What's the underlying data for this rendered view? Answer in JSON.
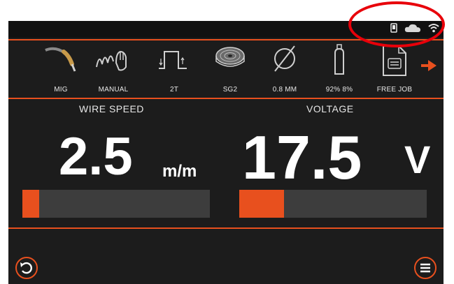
{
  "status_icons": [
    "phone-icon",
    "cloud-icon",
    "wifi-icon"
  ],
  "toolbar": {
    "items": [
      {
        "label": "MIG",
        "icon": "mig-torch-icon"
      },
      {
        "label": "MANUAL",
        "icon": "manual-mode-icon"
      },
      {
        "label": "2T",
        "icon": "trigger-2t-icon"
      },
      {
        "label": "SG2",
        "icon": "wire-spool-icon"
      },
      {
        "label": "0.8 MM",
        "icon": "wire-diameter-icon"
      },
      {
        "label": "92% 8%",
        "icon": "gas-cylinder-icon"
      },
      {
        "label": "FREE JOB",
        "icon": "job-document-icon"
      }
    ],
    "next_icon": "arrow-right-icon"
  },
  "wire_speed": {
    "title": "WIRE SPEED",
    "value": "2.5",
    "unit": "m/m",
    "level": 0.09
  },
  "voltage": {
    "title": "VOLTAGE",
    "value": "17.5",
    "unit": "V",
    "level": 0.24
  },
  "colors": {
    "accent": "#e8501e",
    "background": "#1c1c1c",
    "bar_track": "#3d3d3d",
    "highlight": "#e8000a"
  }
}
